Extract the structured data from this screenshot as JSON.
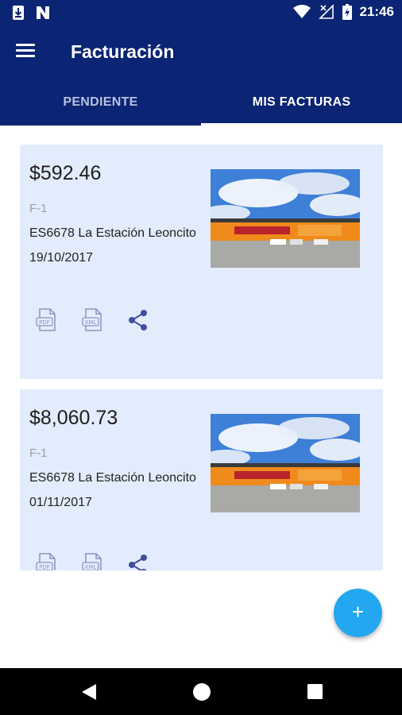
{
  "status_bar": {
    "time": "21:46"
  },
  "app_bar": {
    "title": "Facturación"
  },
  "tabs": [
    {
      "label": "PENDIENTE",
      "active": false
    },
    {
      "label": "MIS FACTURAS",
      "active": true
    }
  ],
  "invoices": [
    {
      "amount": "$592.46",
      "folio": "F-1",
      "station": "ES6678 La Estación Leoncito",
      "date": "19/10/2017",
      "icons": [
        "pdf-icon",
        "xml-icon",
        "share-icon"
      ]
    },
    {
      "amount": "$8,060.73",
      "folio": "F-1",
      "station": "ES6678 La Estación Leoncito",
      "date": "01/11/2017",
      "icons": [
        "pdf-icon",
        "xml-icon",
        "share-icon"
      ]
    }
  ],
  "fab": {
    "label": "+"
  },
  "colors": {
    "primary": "#0b2473",
    "card_bg": "#e3ecfc",
    "accent": "#22a7f0",
    "icon": "#3f4fa0"
  }
}
